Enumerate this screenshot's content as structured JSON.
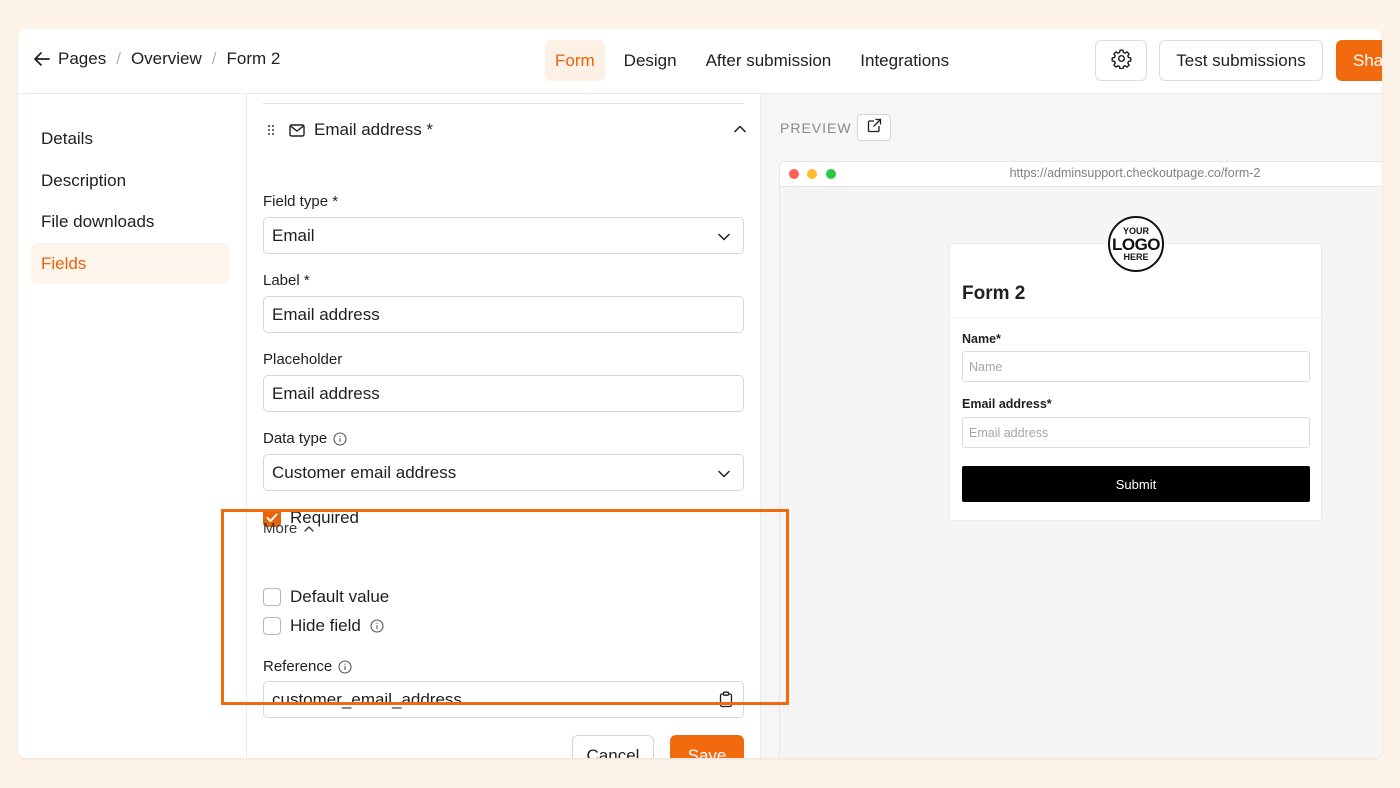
{
  "breadcrumb": {
    "items": [
      "Pages",
      "Overview",
      "Form 2"
    ],
    "separator": "/"
  },
  "tabs": [
    {
      "label": "Form",
      "active": true
    },
    {
      "label": "Design",
      "active": false
    },
    {
      "label": "After submission",
      "active": false
    },
    {
      "label": "Integrations",
      "active": false
    }
  ],
  "header": {
    "test_label": "Test submissions",
    "share_label": "Share"
  },
  "sidebar": {
    "items": [
      "Details",
      "Description",
      "File downloads",
      "Fields"
    ],
    "active": "Fields"
  },
  "field": {
    "title": "Email address *",
    "field_type_label": "Field type *",
    "field_type_value": "Email",
    "label_label": "Label *",
    "label_value": "Email address",
    "placeholder_label": "Placeholder",
    "placeholder_value": "Email address",
    "data_type_label": "Data type",
    "data_type_value": "Customer email address",
    "required_label": "Required",
    "required_checked": true,
    "more_label": "More",
    "default_value_label": "Default value",
    "hide_field_label": "Hide field",
    "reference_label": "Reference",
    "reference_value": "customer_email_address"
  },
  "actions": {
    "cancel_label": "Cancel",
    "save_label": "Save"
  },
  "preview": {
    "label": "PREVIEW",
    "url": "https://adminsupport.checkoutpage.co/form-2",
    "logo_lines": [
      "YOUR",
      "LOGO",
      "HERE"
    ],
    "form_title": "Form 2",
    "name_label": "Name",
    "name_placeholder": "Name",
    "email_label": "Email address",
    "email_placeholder": "Email address",
    "required_mark": "*",
    "submit_label": "Submit"
  },
  "colors": {
    "accent": "#f26a0e",
    "accent_text": "#e8620a",
    "background": "#fdf3e9"
  }
}
